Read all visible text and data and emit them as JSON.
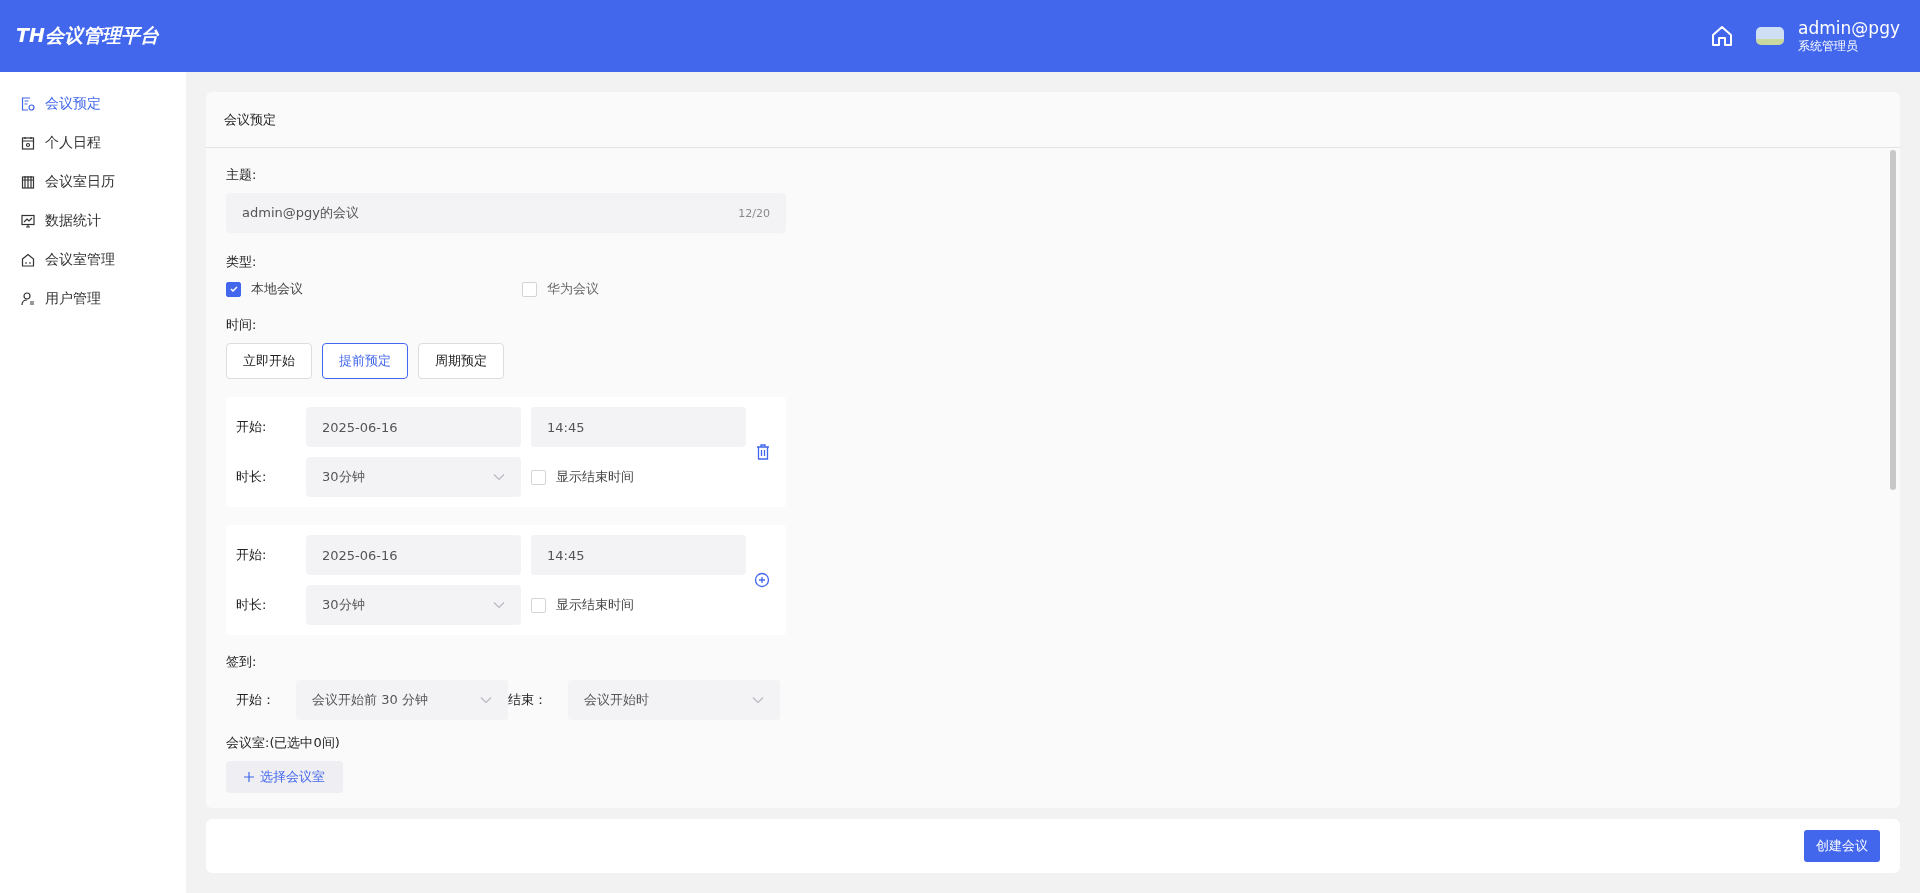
{
  "header": {
    "logo": "TH会议管理平台",
    "user": {
      "name": "admin@pgy",
      "role": "系统管理员"
    }
  },
  "sidebar": {
    "items": [
      {
        "label": "会议预定",
        "kind": "booking",
        "selected": true
      },
      {
        "label": "个人日程",
        "kind": "schedule",
        "selected": false
      },
      {
        "label": "会议室日历",
        "kind": "calendar",
        "selected": false
      },
      {
        "label": "数据统计",
        "kind": "stats",
        "selected": false
      },
      {
        "label": "会议室管理",
        "kind": "room",
        "selected": false
      },
      {
        "label": "用户管理",
        "kind": "user",
        "selected": false
      }
    ]
  },
  "page": {
    "title": "会议预定"
  },
  "form": {
    "subject": {
      "label": "主题:",
      "value": "admin@pgy的会议",
      "counter": "12/20"
    },
    "type": {
      "label": "类型:",
      "options": [
        {
          "label": "本地会议",
          "checked": true
        },
        {
          "label": "华为会议",
          "checked": false
        }
      ]
    },
    "time": {
      "label": "时间:",
      "modes": [
        {
          "label": "立即开始",
          "selected": false
        },
        {
          "label": "提前预定",
          "selected": true
        },
        {
          "label": "周期预定",
          "selected": false
        }
      ]
    },
    "periods": [
      {
        "start_label": "开始:",
        "date": "2025-06-16",
        "time": "14:45",
        "duration_label": "时长:",
        "duration": "30分钟",
        "show_end": {
          "label": "显示结束时间",
          "checked": false
        },
        "kind": "delete"
      },
      {
        "start_label": "开始:",
        "date": "2025-06-16",
        "time": "14:45",
        "duration_label": "时长:",
        "duration": "30分钟",
        "show_end": {
          "label": "显示结束时间",
          "checked": false
        },
        "kind": "add"
      }
    ],
    "checkin": {
      "label": "签到:",
      "start_label": "开始：",
      "start": "会议开始前 30 分钟",
      "end_label": "结束：",
      "end": "会议开始时"
    },
    "rooms": {
      "label": "会议室:(已选中0间)",
      "button": "选择会议室"
    }
  },
  "footer": {
    "submit": "创建会议"
  }
}
